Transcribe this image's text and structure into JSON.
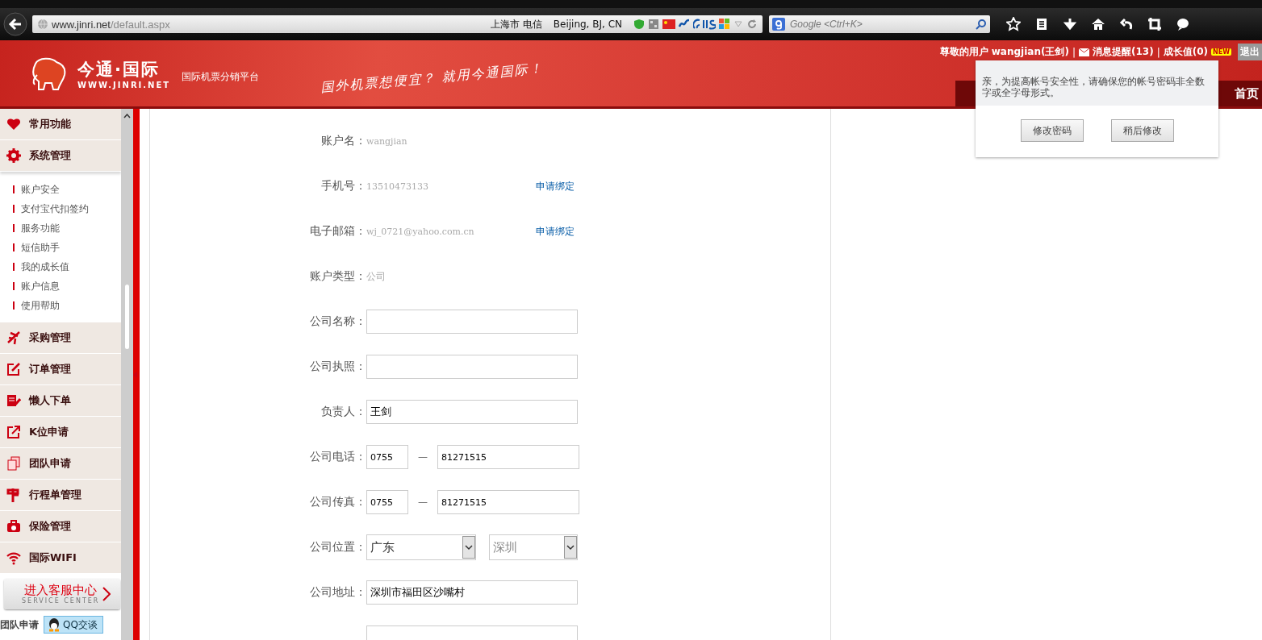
{
  "browser": {
    "url_host": "www.jinri.net",
    "url_path": "/default.aspx",
    "location": "上海市 电信",
    "geo": "Beijing, BJ, CN",
    "search_placeholder": "Google <Ctrl+K>"
  },
  "header": {
    "logo_title": "今通·国际",
    "logo_url": "WWW.JINRI.NET",
    "tagline": "国际机票分销平台",
    "slogan": "国外机票想便宜？ 就用今通国际！",
    "user": "尊敬的用户 wangjian(王剑)",
    "separator": "|",
    "messages": "消息提醒(13)",
    "growth": "成长值(0)",
    "new_badge": "NEW",
    "logout": "退出",
    "nav": [
      "首页"
    ]
  },
  "popup": {
    "message": "亲，为提高帐号安全性，请确保您的帐号密码非全数字或全字母形式。",
    "buttons": [
      "修改密码",
      "稍后修改"
    ]
  },
  "sidebar": {
    "items": [
      {
        "label": "常用功能"
      },
      {
        "label": "系统管理",
        "expanded": true,
        "children": [
          {
            "label": "账户安全"
          },
          {
            "label": "支付宝代扣签约"
          },
          {
            "label": "服务功能"
          },
          {
            "label": "短信助手"
          },
          {
            "label": "我的成长值"
          },
          {
            "label": "账户信息"
          },
          {
            "label": "使用帮助"
          }
        ]
      },
      {
        "label": "采购管理"
      },
      {
        "label": "订单管理"
      },
      {
        "label": "懒人下单"
      },
      {
        "label": "K位申请"
      },
      {
        "label": "团队申请"
      },
      {
        "label": "行程单管理"
      },
      {
        "label": "保险管理"
      },
      {
        "label": "国际WIFI"
      }
    ],
    "service_center": {
      "title": "进入客服中心",
      "subtitle": "SERVICE CENTER"
    },
    "footer_label": "团队申请",
    "qq_button": "QQ交谈"
  },
  "form": {
    "rows": [
      {
        "kind": "mono_text",
        "label": "账户名：",
        "value": "wangjian"
      },
      {
        "kind": "mono_text",
        "label": "手机号：",
        "value": "13510473133",
        "link": "申请绑定"
      },
      {
        "kind": "mono_text",
        "label": "电子邮箱：",
        "value": "wj_0721@yahoo.com.cn",
        "link": "申请绑定"
      },
      {
        "kind": "text",
        "label": "账户类型：",
        "value": "公司"
      },
      {
        "kind": "input",
        "label": "公司名称：",
        "value": ""
      },
      {
        "kind": "input",
        "label": "公司执照：",
        "value": ""
      },
      {
        "kind": "input",
        "label": "负责人：",
        "value": "王剑"
      },
      {
        "kind": "phone",
        "label": "公司电话：",
        "area": "0755",
        "separator": "—",
        "number": "81271515"
      },
      {
        "kind": "phone",
        "label": "公司传真：",
        "area": "0755",
        "separator": "—",
        "number": "81271515"
      },
      {
        "kind": "select",
        "label": "公司位置：",
        "province": "广东",
        "city": "深圳"
      },
      {
        "kind": "input",
        "label": "公司地址：",
        "value": "深圳市福田区沙嘴村"
      },
      {
        "kind": "input",
        "value": ""
      }
    ]
  }
}
